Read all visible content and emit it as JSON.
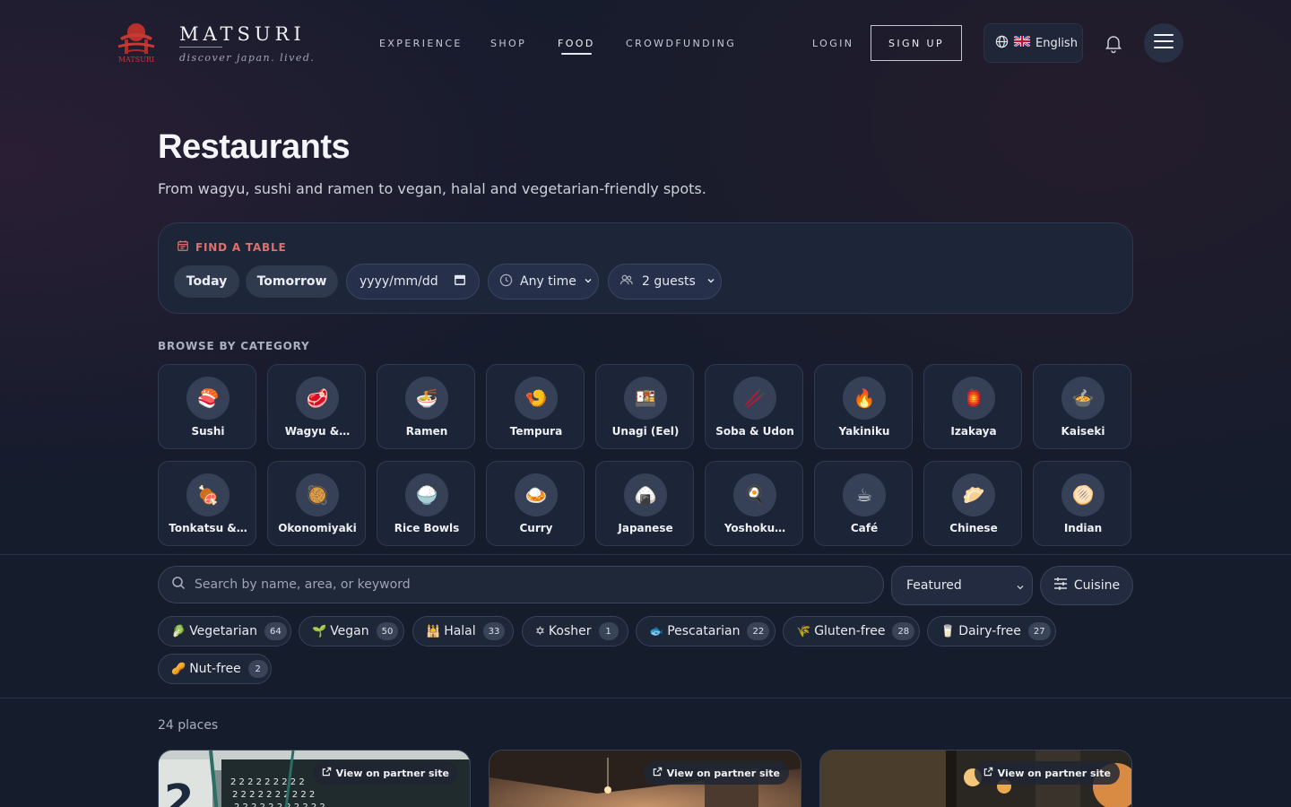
{
  "brand": {
    "name": "MATSURI",
    "tagline": "discover japan. lived.",
    "emblem_text": "MATSURI"
  },
  "nav": {
    "items": [
      {
        "label": "EXPERIENCE"
      },
      {
        "label": "SHOP"
      },
      {
        "label": "FOOD"
      },
      {
        "label": "CROWDFUNDING"
      }
    ],
    "active": "FOOD",
    "login": "LOGIN",
    "signup": "SIGN UP",
    "language": "English",
    "language_flag": "uk-flag-icon"
  },
  "page": {
    "title": "Restaurants",
    "subtitle": "From wagyu, sushi and ramen to vegan, halal and vegetarian-friendly spots."
  },
  "find_table": {
    "label": "FIND A TABLE",
    "day_options": [
      "Today",
      "Tomorrow"
    ],
    "date_placeholder": "yyyy/mm/dd",
    "time_value": "Any time",
    "guests_value": "2 guests"
  },
  "categories": {
    "label": "BROWSE BY CATEGORY",
    "items": [
      {
        "label": "Sushi",
        "icon": "🍣"
      },
      {
        "label": "Wagyu &…",
        "icon": "🥩"
      },
      {
        "label": "Ramen",
        "icon": "🍜"
      },
      {
        "label": "Tempura",
        "icon": "🍤"
      },
      {
        "label": "Unagi (Eel)",
        "icon": "🍱"
      },
      {
        "label": "Soba & Udon",
        "icon": "🥢"
      },
      {
        "label": "Yakiniku",
        "icon": "🔥"
      },
      {
        "label": "Izakaya",
        "icon": "🏮"
      },
      {
        "label": "Kaiseki",
        "icon": "🍲"
      },
      {
        "label": "Tonkatsu &…",
        "icon": "🍖"
      },
      {
        "label": "Okonomiyaki",
        "icon": "🥘"
      },
      {
        "label": "Rice Bowls",
        "icon": "🍚"
      },
      {
        "label": "Curry",
        "icon": "🍛"
      },
      {
        "label": "Japanese",
        "icon": "🍙"
      },
      {
        "label": "Yoshoku…",
        "icon": "🍳"
      },
      {
        "label": "Café",
        "icon": "☕"
      },
      {
        "label": "Chinese",
        "icon": "🥟"
      },
      {
        "label": "Indian",
        "icon": "🫓"
      }
    ]
  },
  "search": {
    "placeholder": "Search by name, area, or keyword",
    "sort_value": "Featured",
    "cuisine_label": "Cuisine"
  },
  "diet_filters": [
    {
      "label": "Vegetarian",
      "icon": "🥬",
      "count": "64"
    },
    {
      "label": "Vegan",
      "icon": "🌱",
      "count": "50"
    },
    {
      "label": "Halal",
      "icon": "🕌",
      "count": "33"
    },
    {
      "label": "Kosher",
      "icon": "✡",
      "count": "1"
    },
    {
      "label": "Pescatarian",
      "icon": "🐟",
      "count": "22"
    },
    {
      "label": "Gluten-free",
      "icon": "🌾",
      "count": "28"
    },
    {
      "label": "Dairy-free",
      "icon": "🥛",
      "count": "27"
    },
    {
      "label": "Nut-free",
      "icon": "🥜",
      "count": "2"
    }
  ],
  "results": {
    "count_text": "24 places",
    "partner_label": "View on partner site",
    "cards": [
      {
        "image": "ramen-shop-interior"
      },
      {
        "image": "restaurant-warm-interior"
      },
      {
        "image": "restaurant-lantern-interior"
      }
    ]
  },
  "colors": {
    "background": "#151c2c",
    "accent_red": "#e0706c",
    "card": "#1d2638"
  }
}
